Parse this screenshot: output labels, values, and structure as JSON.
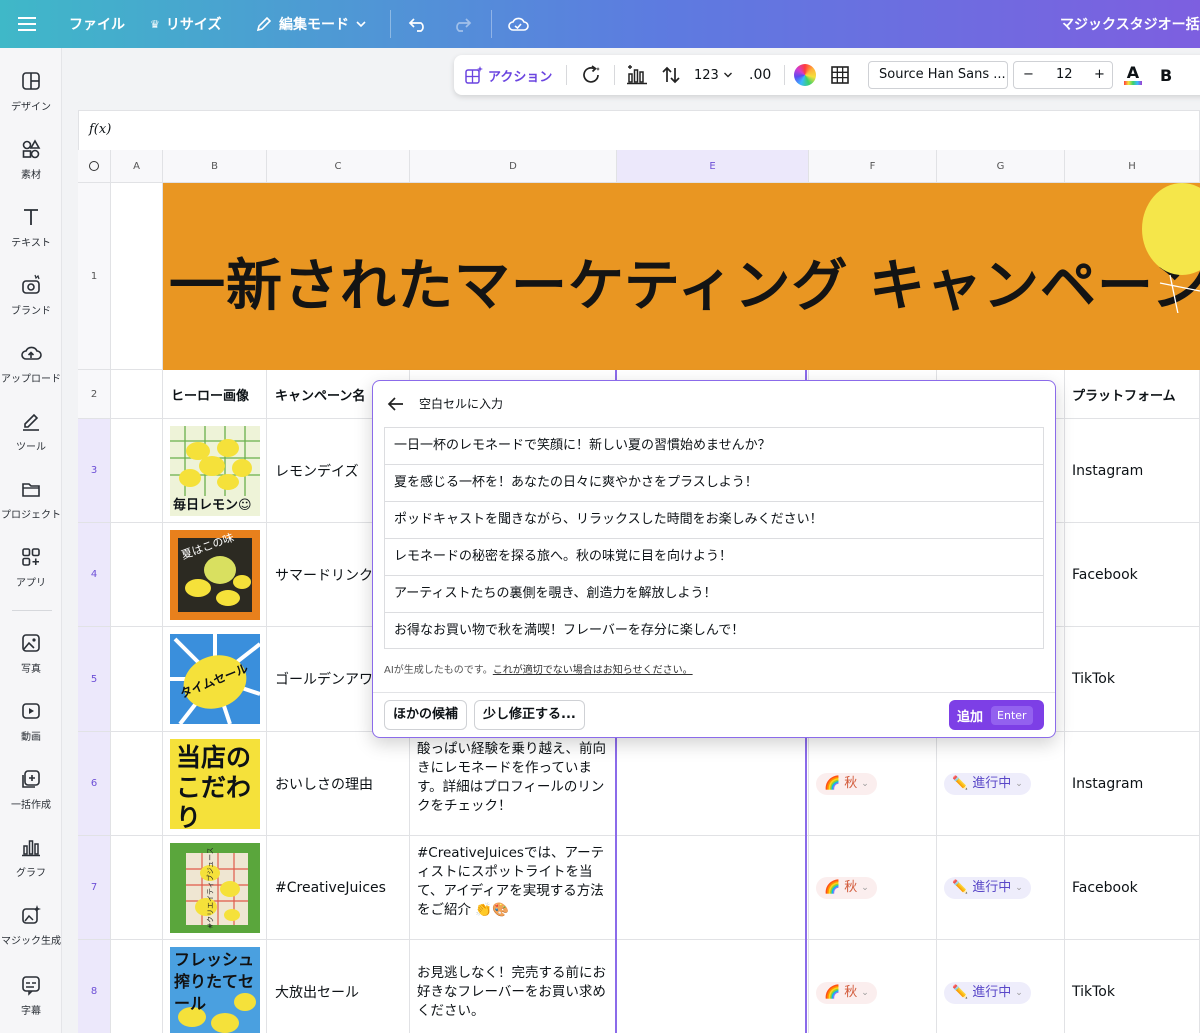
{
  "topbar": {
    "menu_icon": "hamburger-icon",
    "file": "ファイル",
    "resize": "リサイズ",
    "edit_mode": "編集モード",
    "right_title": "マジックスタジオー括編"
  },
  "sidebar": {
    "items": [
      {
        "label": "デザイン",
        "icon": "layout-icon"
      },
      {
        "label": "素材",
        "icon": "elements-icon"
      },
      {
        "label": "テキスト",
        "icon": "text-icon"
      },
      {
        "label": "ブランド",
        "icon": "brand-icon"
      },
      {
        "label": "アップロード",
        "icon": "upload-icon"
      },
      {
        "label": "ツール",
        "icon": "draw-icon"
      },
      {
        "label": "プロジェクト",
        "icon": "folder-icon"
      },
      {
        "label": "アプリ",
        "icon": "apps-icon"
      },
      {
        "label": "写真",
        "icon": "photo-icon"
      },
      {
        "label": "動画",
        "icon": "video-icon"
      },
      {
        "label": "一括作成",
        "icon": "bulk-create-icon"
      },
      {
        "label": "グラフ",
        "icon": "chart-icon"
      },
      {
        "label": "マジック生成",
        "icon": "magic-media-icon"
      },
      {
        "label": "字幕",
        "icon": "captions-icon"
      }
    ]
  },
  "toolbar": {
    "action": "アクション",
    "number_format": "123",
    "decimals": ".00",
    "font": "Source Han Sans ...",
    "font_size": "12",
    "minus": "−",
    "plus": "+",
    "text_color": "A",
    "bold": "B"
  },
  "formula_bar": {
    "label": "f(x)"
  },
  "grid": {
    "columns": [
      "A",
      "B",
      "C",
      "D",
      "E",
      "F",
      "G",
      "H"
    ],
    "rows": [
      "1",
      "2",
      "3",
      "4",
      "5",
      "6",
      "7",
      "8"
    ],
    "banner_title": "一新されたマーケティング キャンペーン",
    "headers": {
      "b": "ヒーロー画像",
      "c": "キャンペーン名",
      "h": "プラットフォーム"
    },
    "data_rows": [
      {
        "thumb_text": "毎日レモン☺",
        "name": "レモンデイズ",
        "copy": "",
        "season": "",
        "status": "",
        "platform": "Instagram"
      },
      {
        "thumb_text": "夏はこの味",
        "name": "サマードリンク",
        "copy": "",
        "season": "",
        "status": "",
        "platform": "Facebook"
      },
      {
        "thumb_text": "タイムセール",
        "name": "ゴールデンアワ",
        "copy": "",
        "season": "",
        "status": "",
        "platform": "TikTok"
      },
      {
        "thumb_text": "当店のこだわり",
        "name": "おいしさの理由",
        "copy": "酸っぱい経験を乗り越え、前向きにレモネードを作っています。詳細はプロフィールのリンクをチェック！",
        "season": "秋",
        "status": "進行中",
        "platform": "Instagram"
      },
      {
        "thumb_text": "#クリエイティブジュース",
        "name": "#CreativeJuices",
        "copy": "#CreativeJuicesでは、アーティストにスポットライトを当て、アイディアを実現する方法をご紹介 👏🎨",
        "season": "秋",
        "status": "進行中",
        "platform": "Facebook"
      },
      {
        "thumb_text": "フレッシュ搾りたてセール",
        "name": "大放出セール",
        "copy": "お見逃しなく！完売する前にお好きなフレーバーをお買い求めください。",
        "season": "秋",
        "status": "進行中",
        "platform": "TikTok"
      }
    ]
  },
  "popover": {
    "title": "空白セルに入力",
    "suggestions": [
      "一日一杯のレモネードで笑顔に！新しい夏の習慣始めませんか？",
      "夏を感じる一杯を！あなたの日々に爽やかさをプラスしよう！",
      "ポッドキャストを聞きながら、リラックスした時間をお楽しみください！",
      "レモネードの秘密を探る旅へ。秋の味覚に目を向けよう！",
      "アーティストたちの裏側を覗き、創造力を解放しよう！",
      "お得なお買い物で秋を満喫！フレーバーを存分に楽しんで！"
    ],
    "disclaimer": "AIが生成したものです。",
    "report_link": "これが適切でない場合はお知らせください。",
    "other_button": "ほかの候補",
    "adjust_button": "少し修正する...",
    "add_button": "追加",
    "add_shortcut": "Enter"
  },
  "colors": {
    "accent": "#7d3fe6",
    "banner": "#e99622",
    "selection": "#8b6bea"
  }
}
